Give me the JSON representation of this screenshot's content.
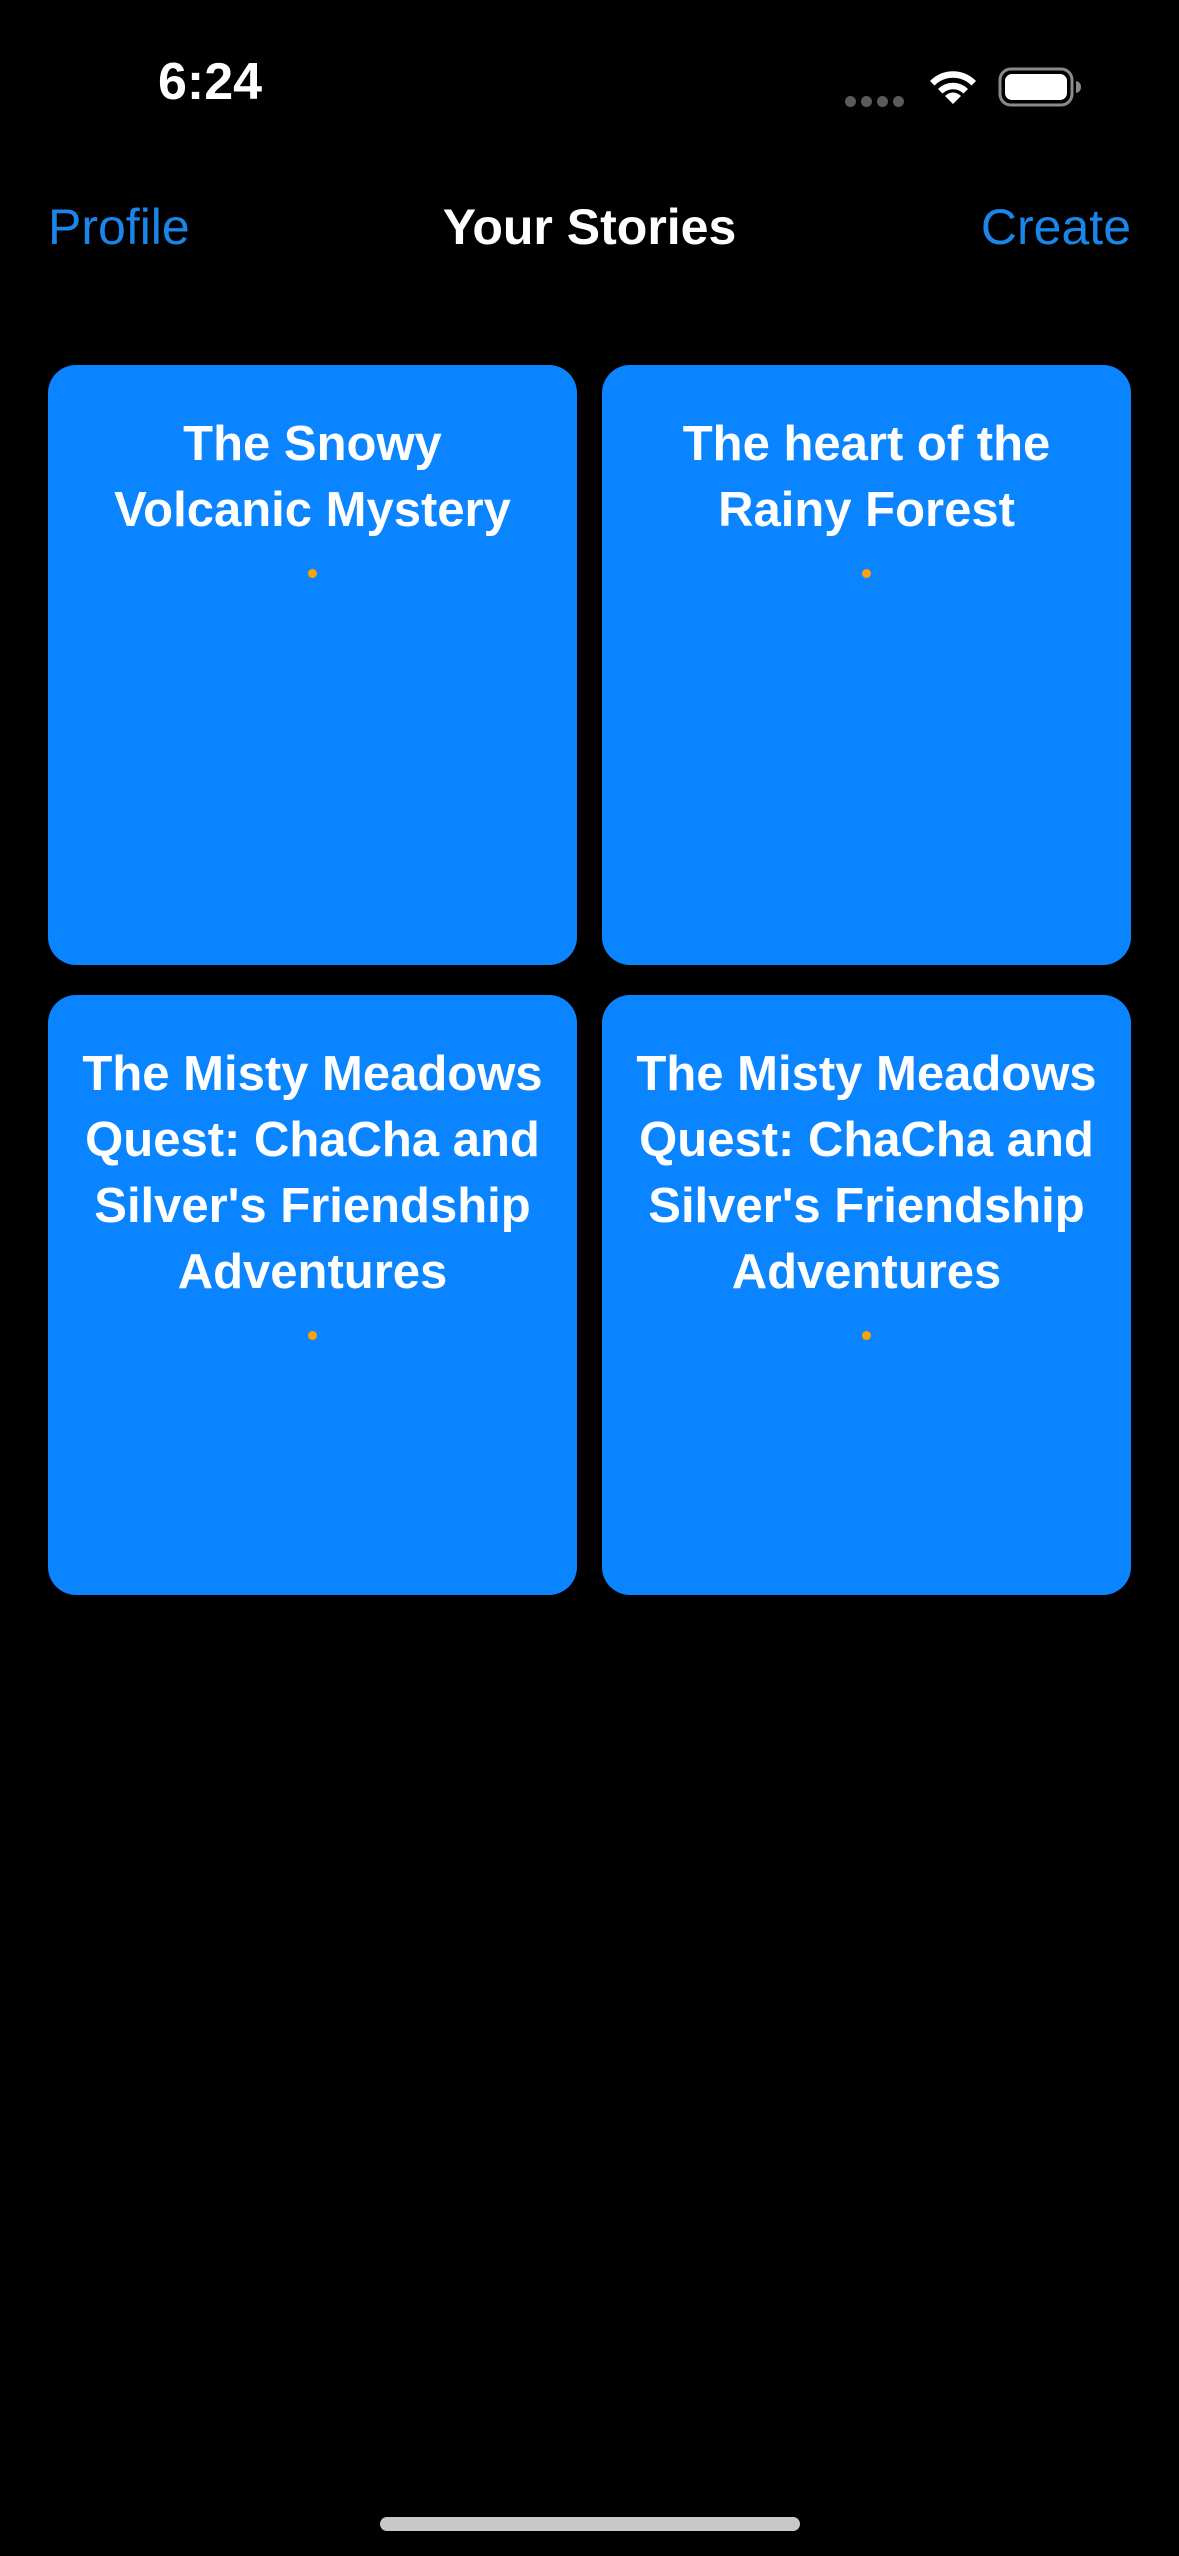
{
  "status_bar": {
    "time": "6:24"
  },
  "nav": {
    "left_label": "Profile",
    "title": "Your Stories",
    "right_label": "Create"
  },
  "stories": [
    {
      "title": "The Snowy Volcanic Mystery"
    },
    {
      "title": "The heart of the Rainy Forest"
    },
    {
      "title": "The Misty Meadows Quest: ChaCha and Silver's Friendship Adventures"
    },
    {
      "title": "The Misty Meadows Quest: ChaCha and Silver's Friendship Adventures"
    }
  ],
  "colors": {
    "background": "#000000",
    "accent": "#1a86ea",
    "card": "#0a84ff",
    "dot": "#ff9f0a"
  },
  "icons": {
    "signal": "cellular-signal-icon",
    "wifi": "wifi-icon",
    "battery": "battery-icon"
  }
}
